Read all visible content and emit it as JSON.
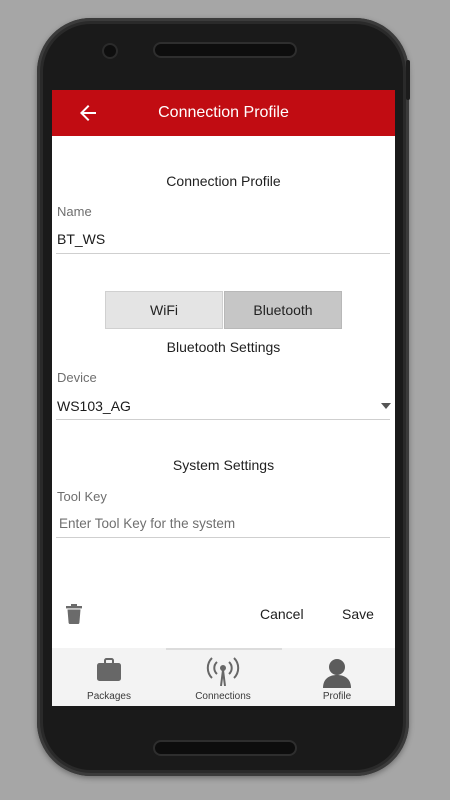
{
  "appbar": {
    "title": "Connection Profile",
    "back_icon": "arrow-left-icon"
  },
  "profile": {
    "section_title": "Connection Profile",
    "name_label": "Name",
    "name_value": "BT_WS"
  },
  "connection_type": {
    "options": [
      "WiFi",
      "Bluetooth"
    ],
    "selected": "Bluetooth"
  },
  "bluetooth": {
    "section_title": "Bluetooth Settings",
    "device_label": "Device",
    "device_value": "WS103_AG"
  },
  "system": {
    "section_title": "System Settings",
    "tool_key_label": "Tool Key",
    "tool_key_placeholder": "Enter Tool Key for the system"
  },
  "actions": {
    "cancel": "Cancel",
    "save": "Save",
    "delete_icon": "trash-icon"
  },
  "bottom_nav": [
    {
      "label": "Packages",
      "icon": "briefcase-icon"
    },
    {
      "label": "Connections",
      "icon": "antenna-icon"
    },
    {
      "label": "Profile",
      "icon": "person-icon"
    }
  ],
  "colors": {
    "appbar": "#c10c12",
    "segment_selected": "#c6c6c6",
    "segment_unselected": "#e4e4e4"
  }
}
